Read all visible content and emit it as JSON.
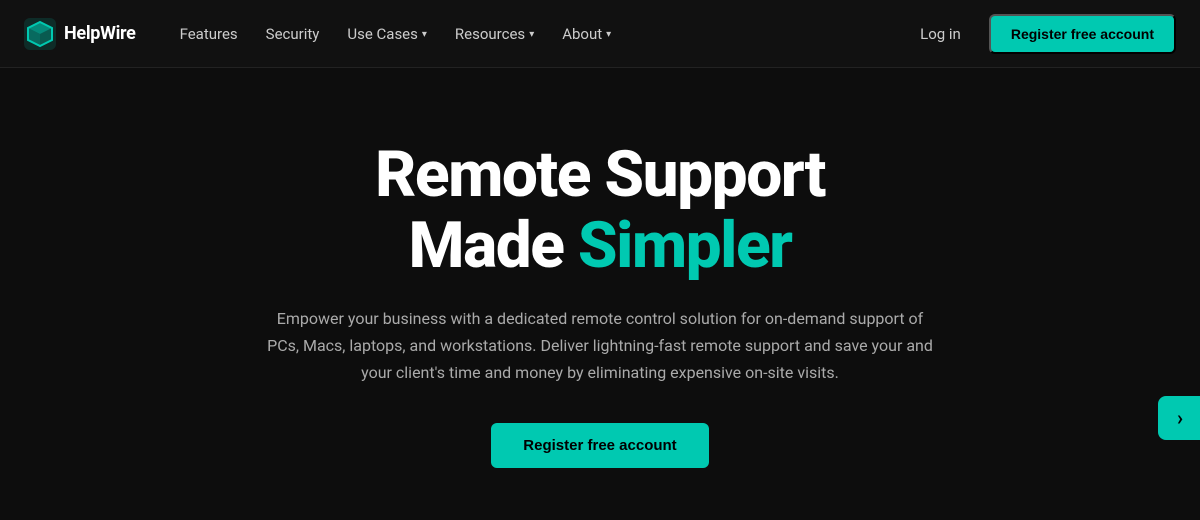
{
  "brand": {
    "name": "HelpWire",
    "logo_alt": "HelpWire logo"
  },
  "nav": {
    "links": [
      {
        "label": "Features",
        "has_dropdown": false
      },
      {
        "label": "Security",
        "has_dropdown": false
      },
      {
        "label": "Use Cases",
        "has_dropdown": true
      },
      {
        "label": "Resources",
        "has_dropdown": true
      },
      {
        "label": "About",
        "has_dropdown": true
      }
    ],
    "login_label": "Log in",
    "register_label": "Register free account"
  },
  "hero": {
    "title_line1": "Remote Support",
    "title_line2_plain": "Made ",
    "title_line2_accent": "Simpler",
    "subtitle": "Empower your business with a dedicated remote control solution for on-demand support of PCs, Macs, laptops, and workstations. Deliver lightning-fast remote support and save your and your client's time and money by eliminating expensive on-site visits.",
    "cta_label": "Register free account"
  }
}
